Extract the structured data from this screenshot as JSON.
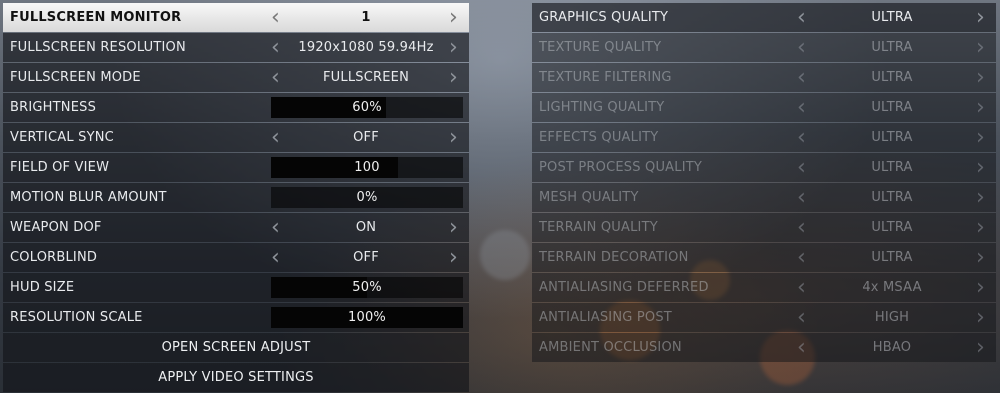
{
  "left_panel": {
    "rows": [
      {
        "label": "FULLSCREEN MONITOR",
        "value": "1",
        "kind": "selector",
        "selected": true
      },
      {
        "label": "FULLSCREEN RESOLUTION",
        "value": "1920x1080 59.94Hz",
        "kind": "selector"
      },
      {
        "label": "FULLSCREEN MODE",
        "value": "FULLSCREEN",
        "kind": "selector"
      },
      {
        "label": "BRIGHTNESS",
        "value": "60%",
        "kind": "slider",
        "level": 0.6
      },
      {
        "label": "VERTICAL SYNC",
        "value": "OFF",
        "kind": "selector"
      },
      {
        "label": "FIELD OF VIEW",
        "value": "100",
        "kind": "slider",
        "level": 0.66
      },
      {
        "label": "MOTION BLUR AMOUNT",
        "value": "0%",
        "kind": "slider",
        "level": 0
      },
      {
        "label": "WEAPON DOF",
        "value": "ON",
        "kind": "selector"
      },
      {
        "label": "COLORBLIND",
        "value": "OFF",
        "kind": "selector"
      },
      {
        "label": "HUD SIZE",
        "value": "50%",
        "kind": "slider",
        "level": 0.5
      },
      {
        "label": "RESOLUTION SCALE",
        "value": "100%",
        "kind": "slider",
        "level": 1.0
      }
    ],
    "actions": [
      {
        "label": "OPEN SCREEN ADJUST"
      },
      {
        "label": "APPLY VIDEO SETTINGS"
      }
    ]
  },
  "right_panel": {
    "rows": [
      {
        "label": "GRAPHICS QUALITY",
        "value": "ULTRA",
        "enabled": true
      },
      {
        "label": "TEXTURE QUALITY",
        "value": "ULTRA",
        "enabled": false
      },
      {
        "label": "TEXTURE FILTERING",
        "value": "ULTRA",
        "enabled": false
      },
      {
        "label": "LIGHTING QUALITY",
        "value": "ULTRA",
        "enabled": false
      },
      {
        "label": "EFFECTS QUALITY",
        "value": "ULTRA",
        "enabled": false
      },
      {
        "label": "POST PROCESS QUALITY",
        "value": "ULTRA",
        "enabled": false
      },
      {
        "label": "MESH QUALITY",
        "value": "ULTRA",
        "enabled": false
      },
      {
        "label": "TERRAIN QUALITY",
        "value": "ULTRA",
        "enabled": false
      },
      {
        "label": "TERRAIN DECORATION",
        "value": "ULTRA",
        "enabled": false
      },
      {
        "label": "ANTIALIASING DEFERRED",
        "value": "4x MSAA",
        "enabled": false
      },
      {
        "label": "ANTIALIASING POST",
        "value": "HIGH",
        "enabled": false
      },
      {
        "label": "AMBIENT OCCLUSION",
        "value": "HBAO",
        "enabled": false
      }
    ]
  },
  "icons": {
    "left_arrow": "chevron-left-icon",
    "right_arrow": "chevron-right-icon"
  },
  "colors": {
    "selected_row": "#f0f0f0",
    "row_bg": "#121418",
    "text": "#e9ebee",
    "slider_fill": "#050505"
  }
}
